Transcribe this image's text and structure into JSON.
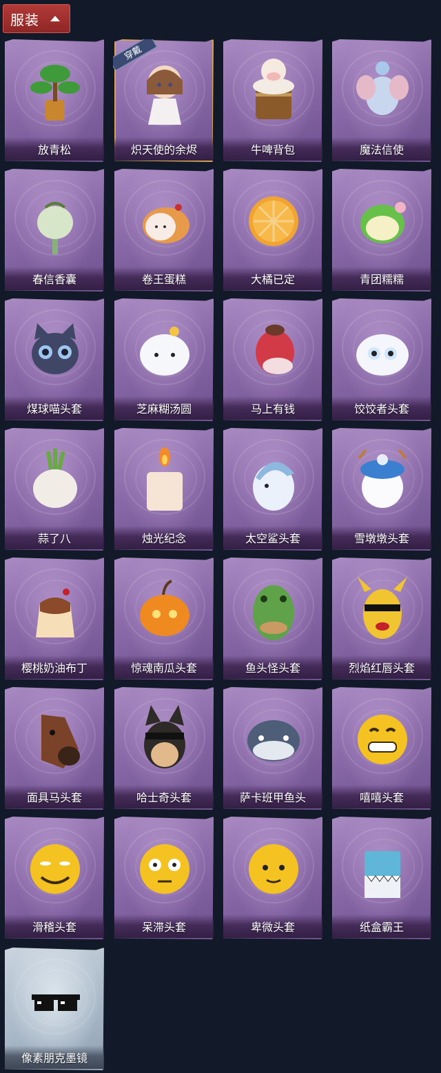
{
  "section": {
    "title": "服装",
    "icon": "chevron-up-icon"
  },
  "items": [
    {
      "name": "放青松",
      "icon": "pine-bonsai-icon"
    },
    {
      "name": "炽天使的余烬",
      "icon": "angel-doll-icon",
      "badge": "穿戴"
    },
    {
      "name": "牛啤背包",
      "icon": "cow-beer-mug-icon"
    },
    {
      "name": "魔法信使",
      "icon": "elephant-messenger-icon"
    },
    {
      "name": "春信香囊",
      "icon": "sachet-icon"
    },
    {
      "name": "卷王蛋糕",
      "icon": "roll-cake-icon"
    },
    {
      "name": "大橘已定",
      "icon": "orange-slice-icon"
    },
    {
      "name": "青团糯糯",
      "icon": "green-rice-ball-icon"
    },
    {
      "name": "煤球喵头套",
      "icon": "black-cat-head-icon"
    },
    {
      "name": "芝麻糊汤圆",
      "icon": "rice-dumpling-icon"
    },
    {
      "name": "马上有钱",
      "icon": "red-horse-icon"
    },
    {
      "name": "饺饺者头套",
      "icon": "dumpling-head-icon"
    },
    {
      "name": "蒜了八",
      "icon": "garlic-icon"
    },
    {
      "name": "烛光纪念",
      "icon": "candle-icon"
    },
    {
      "name": "太空鲨头套",
      "icon": "shark-head-icon"
    },
    {
      "name": "雪墩墩头套",
      "icon": "snowman-head-icon"
    },
    {
      "name": "樱桃奶油布丁",
      "icon": "pudding-icon"
    },
    {
      "name": "惊魂南瓜头套",
      "icon": "pumpkin-head-icon"
    },
    {
      "name": "鱼头怪头套",
      "icon": "fish-mask-icon"
    },
    {
      "name": "烈焰红唇头套",
      "icon": "yellow-mask-icon"
    },
    {
      "name": "面具马头套",
      "icon": "horse-mask-icon"
    },
    {
      "name": "哈士奇头套",
      "icon": "husky-mask-icon"
    },
    {
      "name": "萨卡班甲鱼头",
      "icon": "fish-head-icon"
    },
    {
      "name": "嘻嘻头套",
      "icon": "grin-emoji-icon"
    },
    {
      "name": "滑稽头套",
      "icon": "funny-emoji-icon"
    },
    {
      "name": "呆滞头套",
      "icon": "stunned-emoji-icon"
    },
    {
      "name": "卑微头套",
      "icon": "humble-emoji-icon"
    },
    {
      "name": "纸盒霸王",
      "icon": "box-dino-icon"
    },
    {
      "name": "像素朋克墨镜",
      "icon": "pixel-sunglasses-icon",
      "tier": "silver"
    }
  ],
  "colors": {
    "background": "#121a29",
    "tab": "#b23a37",
    "card_purple": "#8a6aa8",
    "card_silver": "#aab9c8",
    "equipped_border": "#d8a650"
  }
}
